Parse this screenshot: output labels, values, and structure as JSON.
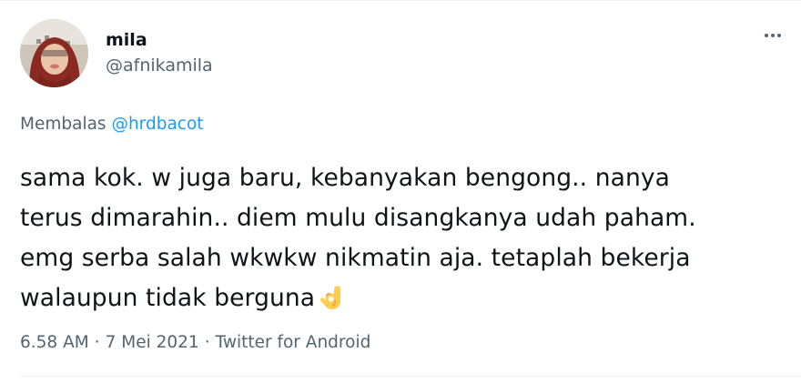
{
  "tweet": {
    "author": {
      "display_name": "mila",
      "handle": "@afnikamila"
    },
    "reply_context": {
      "prefix": "Membalas",
      "mention": "@hrdbacot"
    },
    "text_lines": [
      "sama kok. w juga baru, kebanyakan bengong.. nanya",
      "terus dimarahin.. diem mulu disangkanya udah paham.",
      "emg serba salah wkwkw nikmatin aja. tetaplah bekerja",
      "walaupun tidak berguna"
    ],
    "emoji": "ok-hand-emoji",
    "timestamp": "6.58 AM",
    "separator": "·",
    "date": "7 Mei 2021",
    "source": "Twitter for Android",
    "more_icon": "more-horizontal-icon"
  },
  "colors": {
    "text_primary": "#0f1419",
    "text_secondary": "#536471",
    "link": "#1d9bf0",
    "divider": "#eff3f4"
  }
}
